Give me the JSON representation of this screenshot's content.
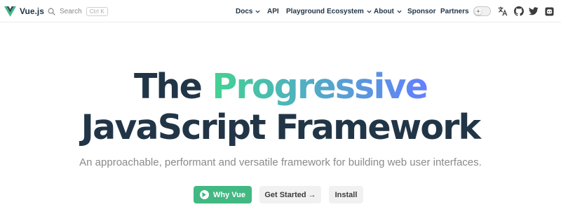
{
  "brand": {
    "name": "Vue.js"
  },
  "search": {
    "label": "Search",
    "shortcut": "Ctrl K"
  },
  "nav": {
    "items": [
      {
        "label": "Docs",
        "dropdown": true
      },
      {
        "label": "API",
        "dropdown": false
      },
      {
        "label": "Playground",
        "dropdown": false
      },
      {
        "label": "Ecosystem",
        "dropdown": true
      },
      {
        "label": "About",
        "dropdown": true
      },
      {
        "label": "Sponsor",
        "dropdown": false
      },
      {
        "label": "Partners",
        "dropdown": false
      }
    ],
    "icons": [
      "theme-switch",
      "translate-icon",
      "github-icon",
      "twitter-icon",
      "discord-icon"
    ]
  },
  "hero": {
    "title_start": "The ",
    "title_accent": "Progressive",
    "title_line2": "JavaScript Framework",
    "tagline": "An approachable, performant and versatile framework for building web user interfaces.",
    "buttons": {
      "why": "Why Vue",
      "get_started": "Get Started →",
      "install": "Install"
    }
  },
  "colors": {
    "brand_green": "#42b883",
    "brand_dark": "#35495e",
    "text": "#213547",
    "gradient_start": "#42d392",
    "gradient_end": "#647eff",
    "secondary_button_bg": "#f1f1f1"
  }
}
